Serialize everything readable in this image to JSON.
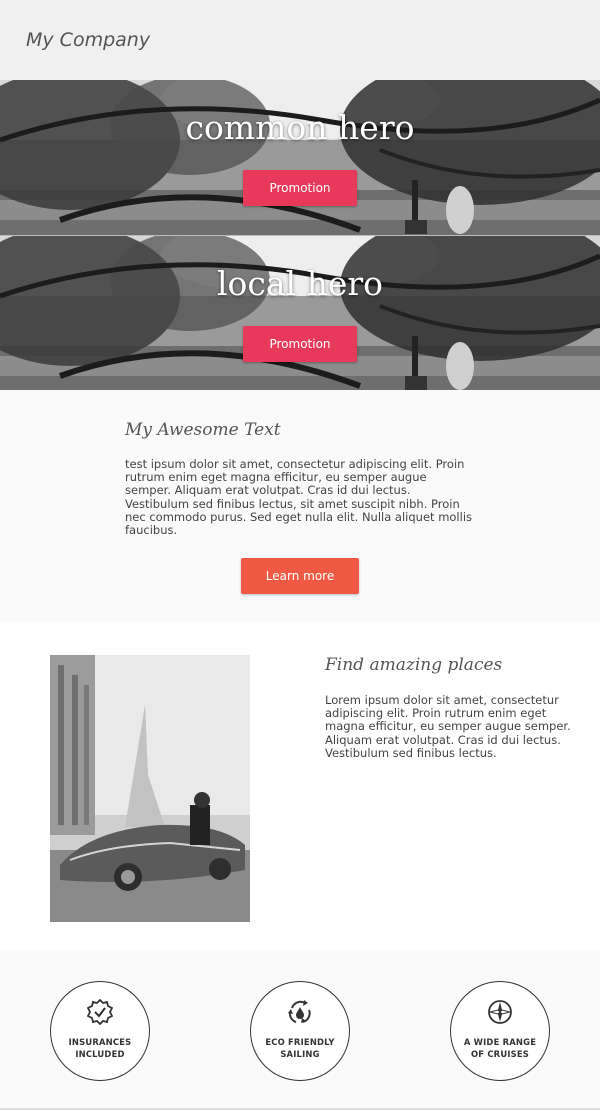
{
  "header": {
    "brand": "My Company"
  },
  "heroes": [
    {
      "title": "common hero",
      "button": "Promotion"
    },
    {
      "title": "local hero",
      "button": "Promotion"
    }
  ],
  "text_section": {
    "heading": "My Awesome Text",
    "body": "test ipsum dolor sit amet, consectetur adipiscing elit. Proin rutrum enim eget magna efficitur, eu semper augue semper. Aliquam erat volutpat. Cras id dui lectus. Vestibulum sed finibus lectus, sit amet suscipit nibh. Proin nec commodo purus. Sed eget nulla elit. Nulla aliquet mollis faucibus.",
    "button": "Learn more"
  },
  "places_section": {
    "heading": "Find amazing places",
    "body": "Lorem ipsum dolor sit amet, consectetur adipiscing elit. Proin rutrum enim eget magna efficitur, eu semper augue semper. Aliquam erat volutpat. Cras id dui lectus. Vestibulum sed finibus lectus."
  },
  "features": [
    {
      "icon": "badge-check-icon",
      "line1": "INSURANCES",
      "line2": "INCLUDED"
    },
    {
      "icon": "recycle-drop-icon",
      "line1": "ECO FRIENDLY",
      "line2": "SAILING"
    },
    {
      "icon": "compass-icon",
      "line1": "A WIDE RANGE",
      "line2": "OF CRUISES"
    }
  ],
  "colors": {
    "promotion_button": "#e8395a",
    "learn_more_button": "#f05a45",
    "header_bg": "#f0f0f0"
  }
}
